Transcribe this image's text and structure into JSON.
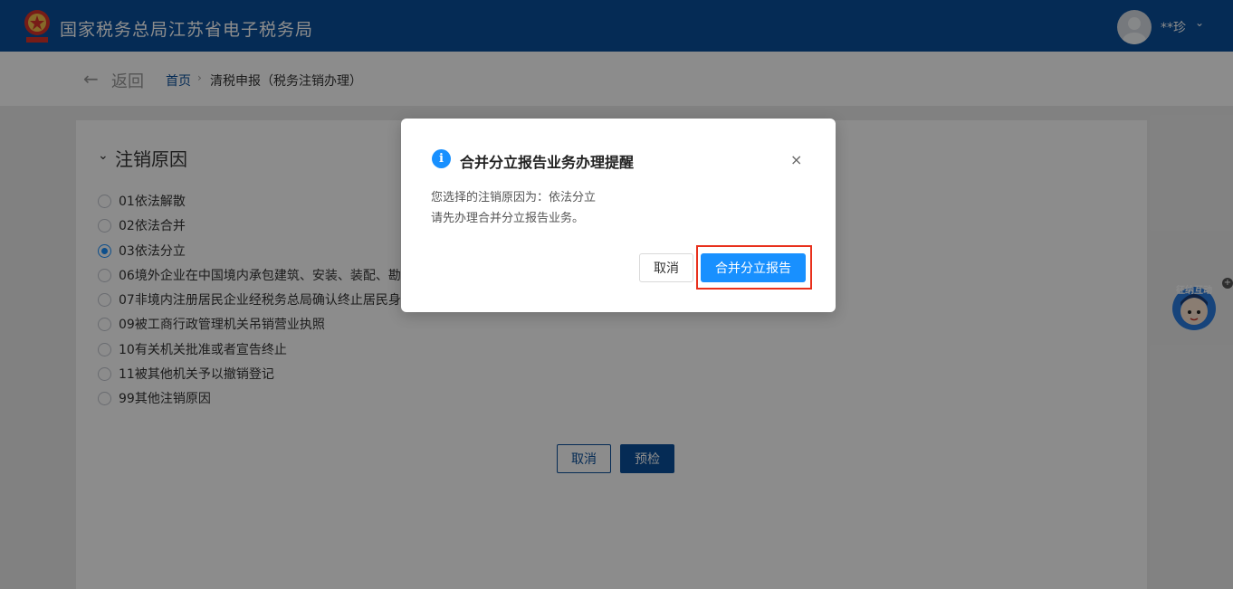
{
  "header": {
    "site_title": "国家税务总局江苏省电子税务局",
    "user_name": "**珍",
    "brand_color": "#0a4f9c"
  },
  "breadcrumb": {
    "back_label": "返回",
    "home": "首页",
    "current": "清税申报（税务注销办理）"
  },
  "form": {
    "section_title": "注销原因",
    "options": [
      {
        "label": "01依法解散",
        "checked": false
      },
      {
        "label": "02依法合并",
        "checked": false
      },
      {
        "label": "03依法分立",
        "checked": true
      },
      {
        "label": "06境外企业在中国境内承包建筑、安装、装配、勘",
        "checked": false
      },
      {
        "label": "07非境内注册居民企业经税务总局确认终止居民身",
        "checked": false
      },
      {
        "label": "09被工商行政管理机关吊销营业执照",
        "checked": false
      },
      {
        "label": "10有关机关批准或者宣告终止",
        "checked": false
      },
      {
        "label": "11被其他机关予以撤销登记",
        "checked": false
      },
      {
        "label": "99其他注销原因",
        "checked": false
      }
    ],
    "cancel_label": "取消",
    "precheck_label": "预检"
  },
  "float_widget": {
    "label": "征纳互动",
    "close_glyph": "+"
  },
  "dialog": {
    "title": "合并分立报告业务办理提醒",
    "line1": "您选择的注销原因为：依法分立",
    "line2": "请先办理合并分立报告业务。",
    "cancel_label": "取消",
    "primary_label": "合并分立报告",
    "close_glyph": "×",
    "info_glyph": "i",
    "accent_color": "#1890ff",
    "highlight_color": "#e8301c"
  }
}
